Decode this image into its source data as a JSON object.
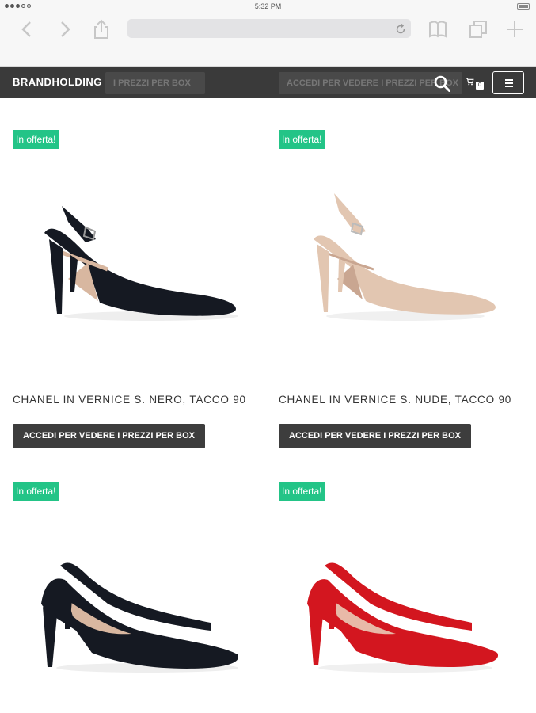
{
  "statusbar": {
    "time": "5:32 PM"
  },
  "header": {
    "logo": "BRANDHOLDING",
    "ghost_text_1": "I PREZZI PER BOX",
    "ghost_text_2": "ACCEDI PER VEDERE I PREZZI PER BOX",
    "cart_count": "0"
  },
  "products": [
    {
      "badge": "In offerta!",
      "name": "CHANEL IN VERNICE S. NERO, TACCO 90",
      "button": "ACCEDI PER VEDERE I PREZZI PER BOX",
      "color": "#151922"
    },
    {
      "badge": "In offerta!",
      "name": "CHANEL IN VERNICE S. NUDE, TACCO 90",
      "button": "ACCEDI PER VEDERE I PREZZI PER BOX",
      "color": "#e2c6b1"
    },
    {
      "badge": "In offerta!",
      "color": "#151922"
    },
    {
      "badge": "In offerta!",
      "color": "#d3161f"
    }
  ],
  "colors": {
    "offer_badge": "#23c487",
    "header_bg": "#3a3a3a",
    "button_bg": "#3d3d3d"
  },
  "icons": [
    "back-icon",
    "forward-icon",
    "share-icon",
    "reload-icon",
    "bookmarks-icon",
    "tabs-icon",
    "new-tab-icon",
    "search-icon",
    "cart-icon",
    "menu-icon"
  ]
}
